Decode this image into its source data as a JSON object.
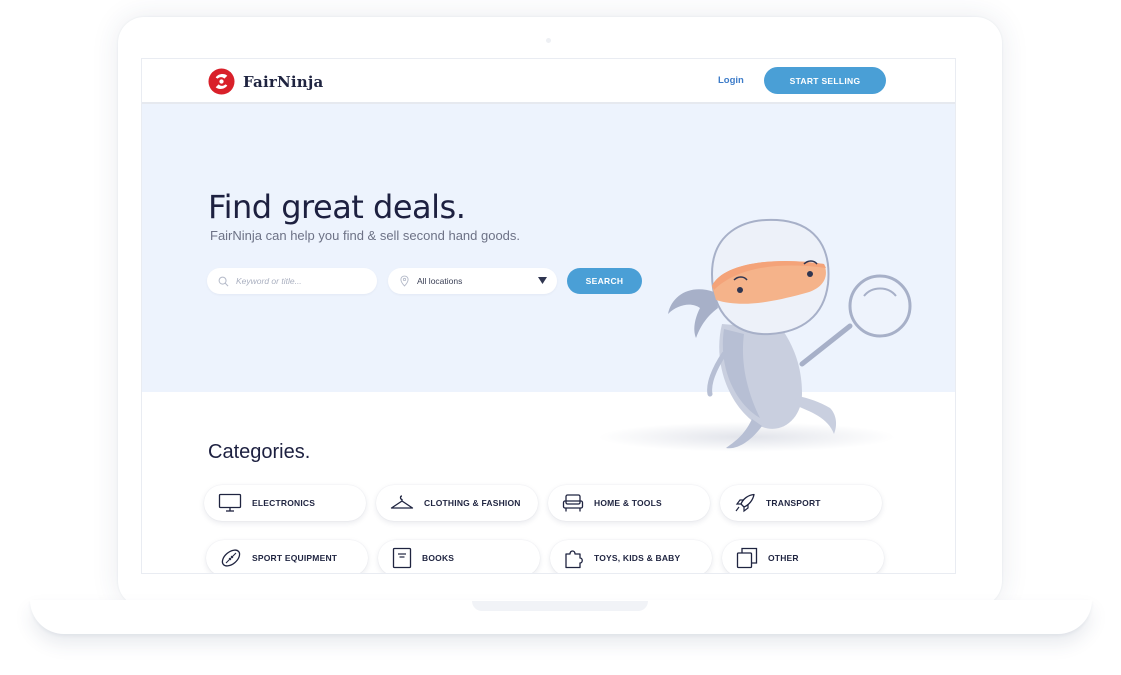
{
  "brand": {
    "name": "FairNinja",
    "logo_color": "#d9202a"
  },
  "nav": {
    "login_label": "Login",
    "cta_label": "START SELLING"
  },
  "hero": {
    "title": "Find great deals.",
    "subtitle": "FairNinja can help you find & sell second hand goods.",
    "search": {
      "placeholder": "Keyword or title...",
      "value": ""
    },
    "location": {
      "selected": "All locations"
    },
    "search_button": "SEARCH"
  },
  "categories": {
    "title": "Categories.",
    "items": [
      {
        "label": "ELECTRONICS",
        "icon": "monitor-icon"
      },
      {
        "label": "CLOTHING & FASHION",
        "icon": "hanger-icon"
      },
      {
        "label": "HOME & TOOLS",
        "icon": "armchair-icon"
      },
      {
        "label": "TRANSPORT",
        "icon": "rocket-icon"
      },
      {
        "label": "SPORT EQUIPMENT",
        "icon": "football-icon"
      },
      {
        "label": "BOOKS",
        "icon": "book-icon"
      },
      {
        "label": "TOYS, KIDS & BABY",
        "icon": "puzzle-icon"
      },
      {
        "label": "OTHER",
        "icon": "copy-icon"
      }
    ]
  },
  "colors": {
    "accent": "#4a9fd6",
    "hero_bg": "#edf3fd",
    "heading": "#1d2040"
  }
}
